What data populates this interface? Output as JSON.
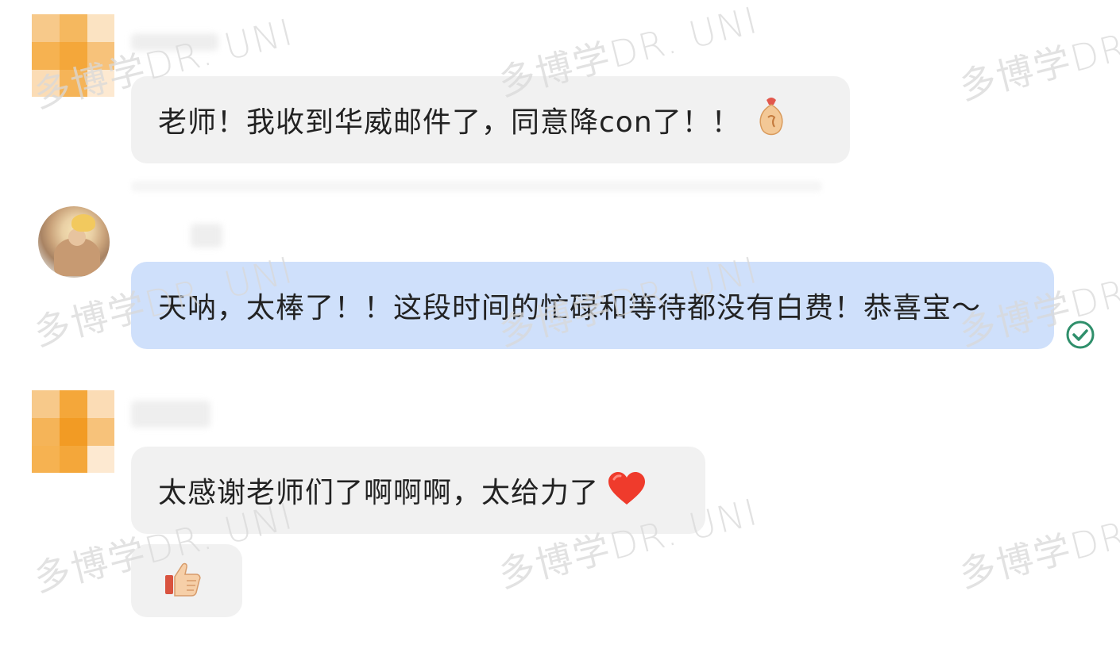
{
  "watermark": {
    "text": "多博学DR. UNI"
  },
  "messages": [
    {
      "sender": "student",
      "text": "老师！我收到华威邮件了，同意降con了！！",
      "emoji": "money-bag-icon"
    },
    {
      "sender": "teacher",
      "text": "天呐，太棒了！！这段时间的忙碌和等待都没有白费！恭喜宝～",
      "status": "read"
    },
    {
      "sender": "student",
      "text": "太感谢老师们了啊啊啊，太给力了",
      "emoji": "heart-icon"
    },
    {
      "sender": "student",
      "text": "",
      "emoji": "thumbs-up-icon"
    }
  ],
  "colors": {
    "bubble_grey": "#f1f1f1",
    "bubble_blue": "#cfe0fb",
    "check_green": "#2f8f6b",
    "avatar_orange": "#f4a73a"
  }
}
